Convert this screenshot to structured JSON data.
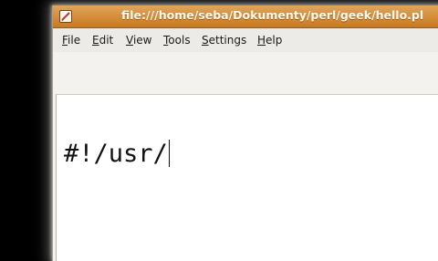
{
  "window": {
    "title": "file:///home/seba/Dokumenty/perl/geek/hello.pl",
    "titlebar_color": "#d0852c",
    "icon": "document-edit-icon"
  },
  "menu": {
    "items": [
      {
        "mnemonic": "F",
        "rest": "ile"
      },
      {
        "mnemonic": "E",
        "rest": "dit"
      },
      {
        "mnemonic": "V",
        "rest": "iew"
      },
      {
        "mnemonic": "T",
        "rest": "ools"
      },
      {
        "mnemonic": "S",
        "rest": "ettings"
      },
      {
        "mnemonic": "H",
        "rest": "elp"
      }
    ]
  },
  "editor": {
    "content": "#!/usr/"
  }
}
